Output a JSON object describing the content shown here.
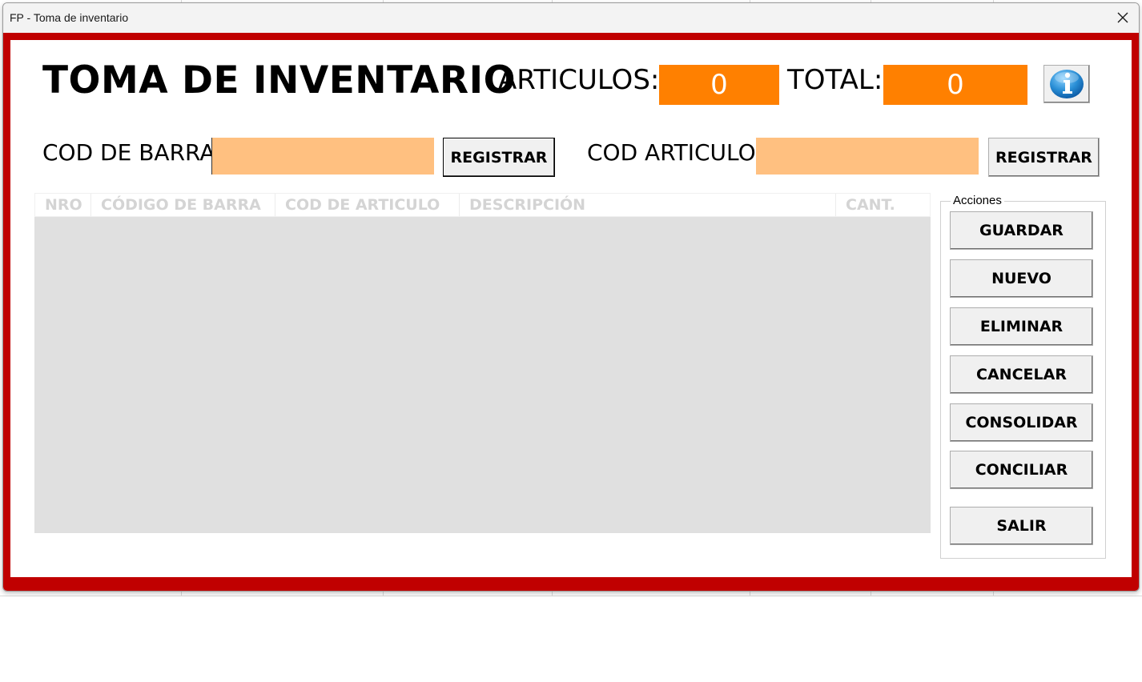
{
  "window": {
    "title": "FP - Toma de inventario"
  },
  "header": {
    "title": "TOMA DE INVENTARIO",
    "articulos_label": "ARTICULOS:",
    "articulos_value": "0",
    "total_label": "TOTAL:",
    "total_value": "0"
  },
  "entry": {
    "barcode_label": "COD DE BARRA",
    "barcode_value": "",
    "barcode_register": "REGISTRAR",
    "article_label": "COD ARTICULO",
    "article_value": "",
    "article_register": "REGISTRAR"
  },
  "grid": {
    "columns": [
      "NRO",
      "CÓDIGO DE BARRA",
      "COD DE ARTICULO",
      "DESCRIPCIÓN",
      "CANT."
    ],
    "rows": []
  },
  "actions": {
    "legend": "Acciones",
    "buttons": [
      "GUARDAR",
      "NUEVO",
      "ELIMINAR",
      "CANCELAR",
      "CONSOLIDAR",
      "CONCILIAR",
      "SALIR"
    ]
  },
  "colors": {
    "frame_red": "#c00000",
    "counter_orange": "#ff8000",
    "input_peach": "#ffc080",
    "grid_gray": "#e0e0e0"
  },
  "icons": {
    "info": "info-icon",
    "close": "close-icon"
  }
}
